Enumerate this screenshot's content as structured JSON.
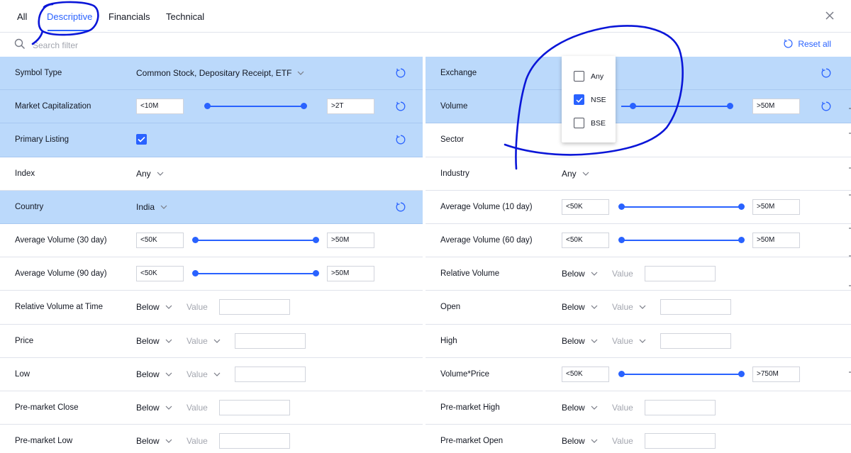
{
  "tabs": [
    {
      "label": "All"
    },
    {
      "label": "Descriptive"
    },
    {
      "label": "Financials"
    },
    {
      "label": "Technical"
    }
  ],
  "search": {
    "placeholder": "Search filter"
  },
  "reset_all_label": "Reset all",
  "accent_color": "#2962ff",
  "active_row_color": "#bbd9fb",
  "left_rows": [
    {
      "label": "Symbol Type",
      "value": "Common Stock, Depositary Receipt, ETF"
    },
    {
      "label": "Market Capitalization",
      "min": "<10M",
      "max": ">2T"
    },
    {
      "label": "Primary Listing"
    },
    {
      "label": "Index",
      "value": "Any"
    },
    {
      "label": "Country",
      "value": "India"
    },
    {
      "label": "Average Volume (30 day)",
      "min": "<50K",
      "max": ">50M"
    },
    {
      "label": "Average Volume (90 day)",
      "min": "<50K",
      "max": ">50M"
    },
    {
      "label": "Relative Volume at Time",
      "op": "Below",
      "value": "Value"
    },
    {
      "label": "Price",
      "op": "Below",
      "value": "Value"
    },
    {
      "label": "Low",
      "op": "Below",
      "value": "Value"
    },
    {
      "label": "Pre-market Close",
      "op": "Below",
      "value": "Value"
    },
    {
      "label": "Pre-market Low",
      "op": "Below",
      "value": "Value"
    }
  ],
  "right_rows": [
    {
      "label": "Exchange"
    },
    {
      "label": "Volume",
      "max": ">50M"
    },
    {
      "label": "Sector"
    },
    {
      "label": "Industry",
      "value": "Any"
    },
    {
      "label": "Average Volume (10 day)",
      "min": "<50K",
      "max": ">50M"
    },
    {
      "label": "Average Volume (60 day)",
      "min": "<50K",
      "max": ">50M"
    },
    {
      "label": "Relative Volume",
      "op": "Below",
      "value": "Value"
    },
    {
      "label": "Open",
      "op": "Below",
      "value": "Value"
    },
    {
      "label": "High",
      "op": "Below",
      "value": "Value"
    },
    {
      "label": "Volume*Price",
      "min": "<50K",
      "max": ">750M"
    },
    {
      "label": "Pre-market High",
      "op": "Below",
      "value": "Value"
    },
    {
      "label": "Pre-market Open",
      "op": "Below",
      "value": "Value"
    }
  ],
  "exchange_popup": {
    "options": [
      {
        "label": "Any",
        "checked": false
      },
      {
        "label": "NSE",
        "checked": true
      },
      {
        "label": "BSE",
        "checked": false
      }
    ]
  }
}
